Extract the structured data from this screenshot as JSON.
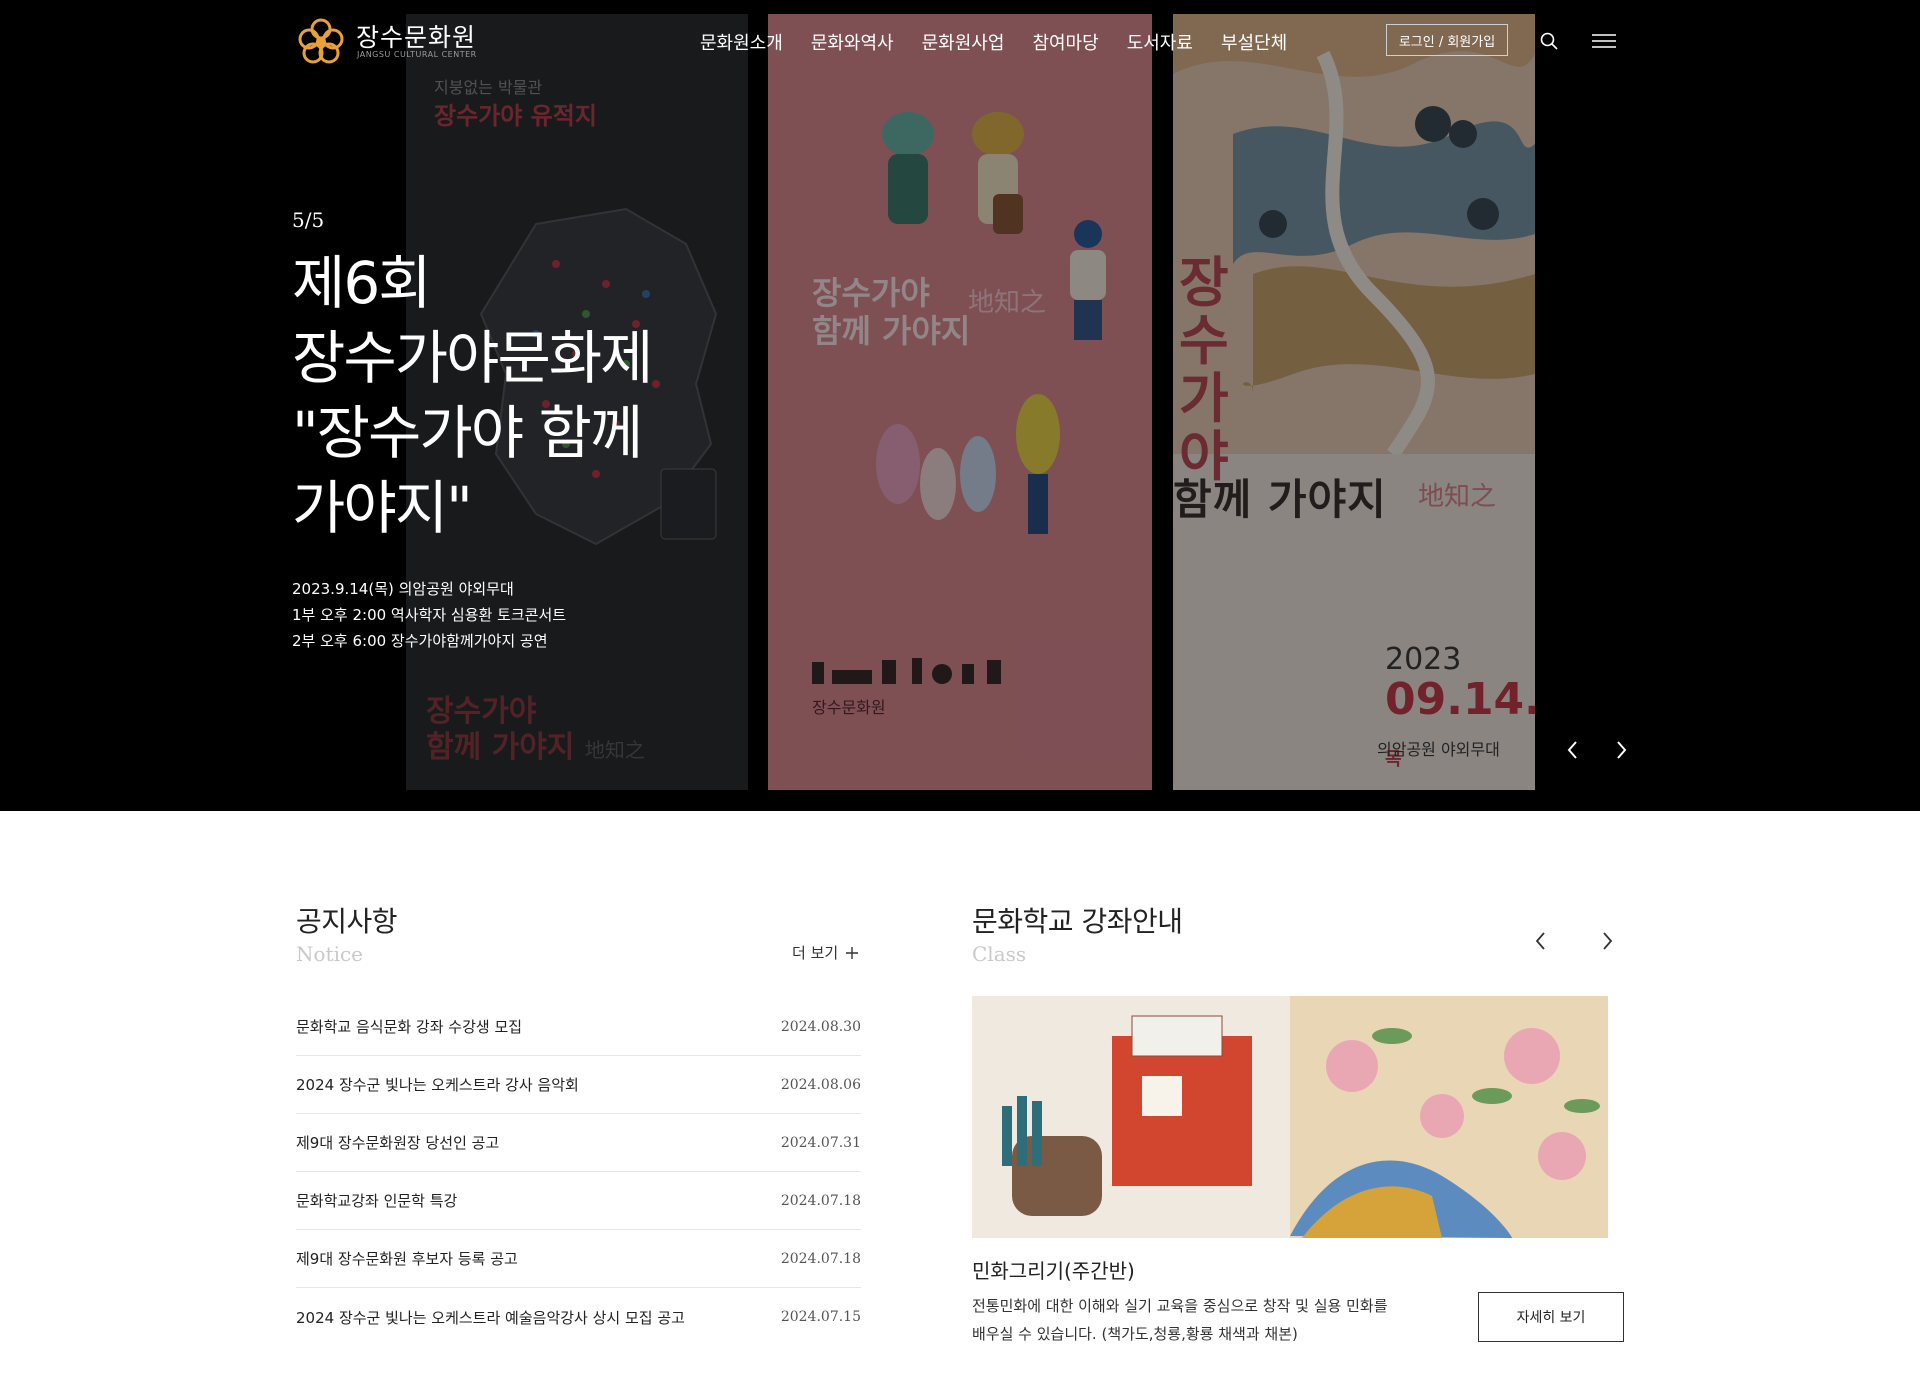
{
  "header": {
    "logo_text": "장수문화원",
    "logo_sub": "JANGSU CULTURAL CENTER",
    "nav": [
      "문화원소개",
      "문화와역사",
      "문화원사업",
      "참여마당",
      "도서자료",
      "부설단체"
    ],
    "login_label": "로그인 / 회원가입"
  },
  "hero": {
    "slide_count": "5/5",
    "title_lines": [
      "제6회",
      "장수가야문화제",
      "\"장수가야 함께",
      "가야지\""
    ],
    "desc_lines": [
      "2023.9.14(목) 의암공원 야외무대",
      "1부 오후 2:00 역사학자 심용환 토크콘서트",
      "2부 오후 6:00 장수가야함께가야지 공연"
    ],
    "poster1": {
      "top": "지붕없는 박물관",
      "title": "장수가야 유적지",
      "bottom_1": "장수가야",
      "bottom_2": "함께 가야지",
      "bottom_han": "地知之"
    },
    "poster2": {
      "title_1": "장수가야",
      "title_2": "함께 가야지",
      "han": "地知之",
      "org": "장수문화원"
    },
    "poster3": {
      "vertical": "장수가야",
      "title": "함께 가야지",
      "han": "地知之",
      "year": "2023",
      "date": "09.14.",
      "dow": "목",
      "venue": "의암공원 야외무대"
    }
  },
  "notice": {
    "title": "공지사항",
    "subtitle": "Notice",
    "more_label": "더 보기",
    "items": [
      {
        "title": "문화학교 음식문화 강좌 수강생 모집",
        "date": "2024.08.30"
      },
      {
        "title": "2024 장수군 빛나는 오케스트라 강사 음악회",
        "date": "2024.08.06"
      },
      {
        "title": "제9대 장수문화원장 당선인 공고",
        "date": "2024.07.31"
      },
      {
        "title": "문화학교강좌 인문학 특강",
        "date": "2024.07.18"
      },
      {
        "title": "제9대 장수문화원 후보자 등록 공고",
        "date": "2024.07.18"
      },
      {
        "title": "2024 장수군 빛나는 오케스트라 예술음악강사 상시 모집 공고",
        "date": "2024.07.15"
      }
    ]
  },
  "class": {
    "title": "문화학교 강좌안내",
    "subtitle": "Class",
    "name": "민화그리기(주간반)",
    "desc": "전통민화에 대한 이해와 실기 교육을 중심으로 창작 및 실용 민화를 배우실 수 있습니다. (책가도,청룡,황룡 채색과 채본)",
    "detail_label": "자세히 보기"
  },
  "colors": {
    "logo_accent": "#e8a13a",
    "hero_bg": "#000000",
    "poster_pink": "#d98a92",
    "poster_red": "#c43b4b"
  },
  "icons": [
    "logo-icon",
    "search-icon",
    "menu-icon",
    "chevron-left-icon",
    "chevron-right-icon",
    "plus-icon"
  ]
}
